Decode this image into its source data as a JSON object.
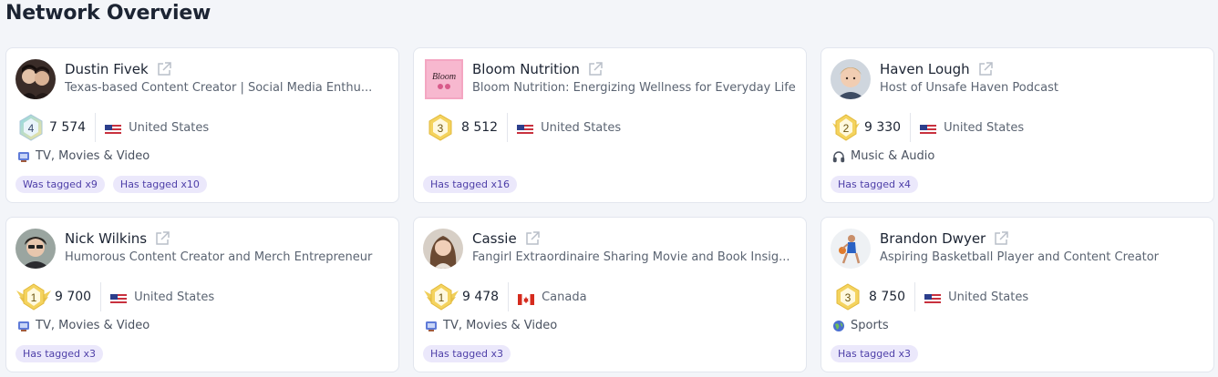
{
  "page": {
    "title": "Network Overview"
  },
  "cards": [
    {
      "name": "Dustin Fivek",
      "bio": "Texas-based Content Creator | Social Media Enthu...",
      "rank": "4",
      "followers": "7 574",
      "country": "United States",
      "category": "TV, Movies & Video",
      "tags": [
        "Was tagged x9",
        "Has tagged x10"
      ]
    },
    {
      "name": "Bloom Nutrition",
      "bio": "Bloom Nutrition: Energizing Wellness for Everyday Life",
      "rank": "3",
      "followers": "8 512",
      "country": "United States",
      "category": "",
      "tags": [
        "Has tagged x16"
      ]
    },
    {
      "name": "Haven Lough",
      "bio": "Host of Unsafe Haven Podcast",
      "rank": "2",
      "followers": "9 330",
      "country": "United States",
      "category": "Music & Audio",
      "tags": [
        "Has tagged x4"
      ]
    },
    {
      "name": "Nick Wilkins",
      "bio": "Humorous Content Creator and Merch Entrepreneur",
      "rank": "1",
      "followers": "9 700",
      "country": "United States",
      "category": "TV, Movies & Video",
      "tags": [
        "Has tagged x3"
      ]
    },
    {
      "name": "Cassie",
      "bio": "Fangirl Extraordinaire Sharing Movie and Book Insig...",
      "rank": "1",
      "followers": "9 478",
      "country": "Canada",
      "category": "TV, Movies & Video",
      "tags": [
        "Has tagged x3"
      ]
    },
    {
      "name": "Brandon Dwyer",
      "bio": "Aspiring Basketball Player and Content Creator",
      "rank": "3",
      "followers": "8 750",
      "country": "United States",
      "category": "Sports",
      "tags": [
        "Has tagged x3"
      ]
    }
  ],
  "icons": {
    "external": "external-link-icon",
    "tv": "tv-icon",
    "music": "headphones-icon",
    "sports": "globe-icon",
    "us_flag": "us-flag-icon",
    "ca_flag": "canada-flag-icon"
  },
  "colors": {
    "background": "#f3f5f9",
    "card": "#ffffff",
    "tag_bg": "#ebe8fb",
    "tag_text": "#4e3fa8",
    "badge_gold": "#f4d35e"
  }
}
